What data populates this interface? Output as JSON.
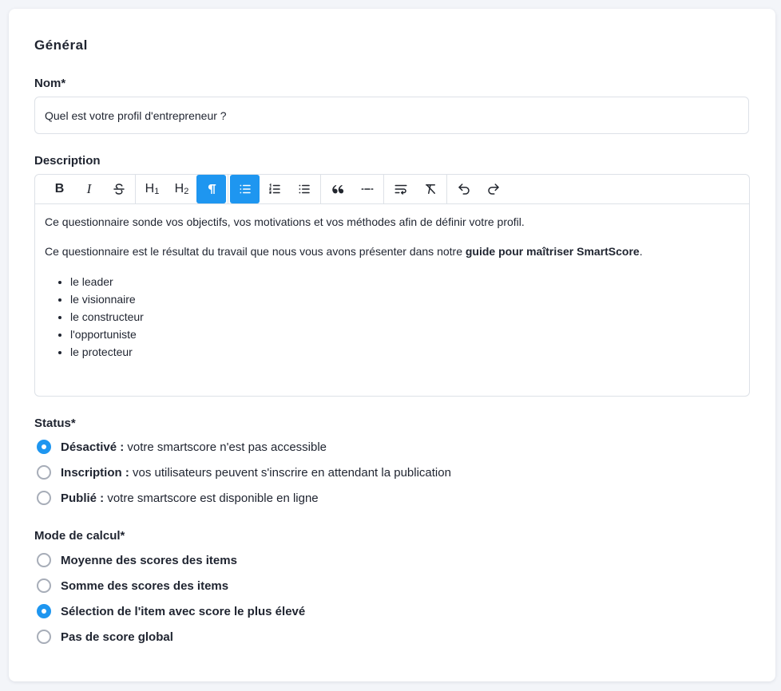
{
  "general": {
    "title": "Général"
  },
  "name_field": {
    "label": "Nom*",
    "value": "Quel est votre profil d'entrepreneur ?"
  },
  "description": {
    "label": "Description",
    "toolbar": {
      "bold": "B",
      "italic": "I",
      "h1": "H",
      "h1_num": "1",
      "h2": "H",
      "h2_num": "2"
    },
    "paragraph1": "Ce questionnaire sonde vos objectifs, vos motivations et vos méthodes afin de définir votre profil.",
    "paragraph2_start": "Ce questionnaire est le résultat du travail que nous vous avons présenter dans notre ",
    "paragraph2_bold": "guide pour maîtriser SmartScore",
    "paragraph2_end": ".",
    "list": [
      "le leader",
      "le visionnaire",
      "le constructeur",
      "l'opportuniste",
      "le protecteur"
    ]
  },
  "status": {
    "label": "Status*",
    "options": [
      {
        "bold": "Désactivé :",
        "text": " votre smartscore n'est pas accessible",
        "checked": true
      },
      {
        "bold": "Inscription :",
        "text": " vos utilisateurs peuvent s'inscrire en attendant la publication",
        "checked": false
      },
      {
        "bold": "Publié :",
        "text": " votre smartscore est disponible en ligne",
        "checked": false
      }
    ]
  },
  "calc_mode": {
    "label": "Mode de calcul*",
    "options": [
      {
        "bold": "Moyenne des scores des items",
        "checked": false
      },
      {
        "bold": "Somme des scores des items",
        "checked": false
      },
      {
        "bold": "Sélection de l'item avec score le plus élevé",
        "checked": true
      },
      {
        "bold": "Pas de score global",
        "checked": false
      }
    ]
  },
  "colors": {
    "accent": "#1e96f0",
    "border": "#dde1e7",
    "background": "#f3f5f9"
  }
}
